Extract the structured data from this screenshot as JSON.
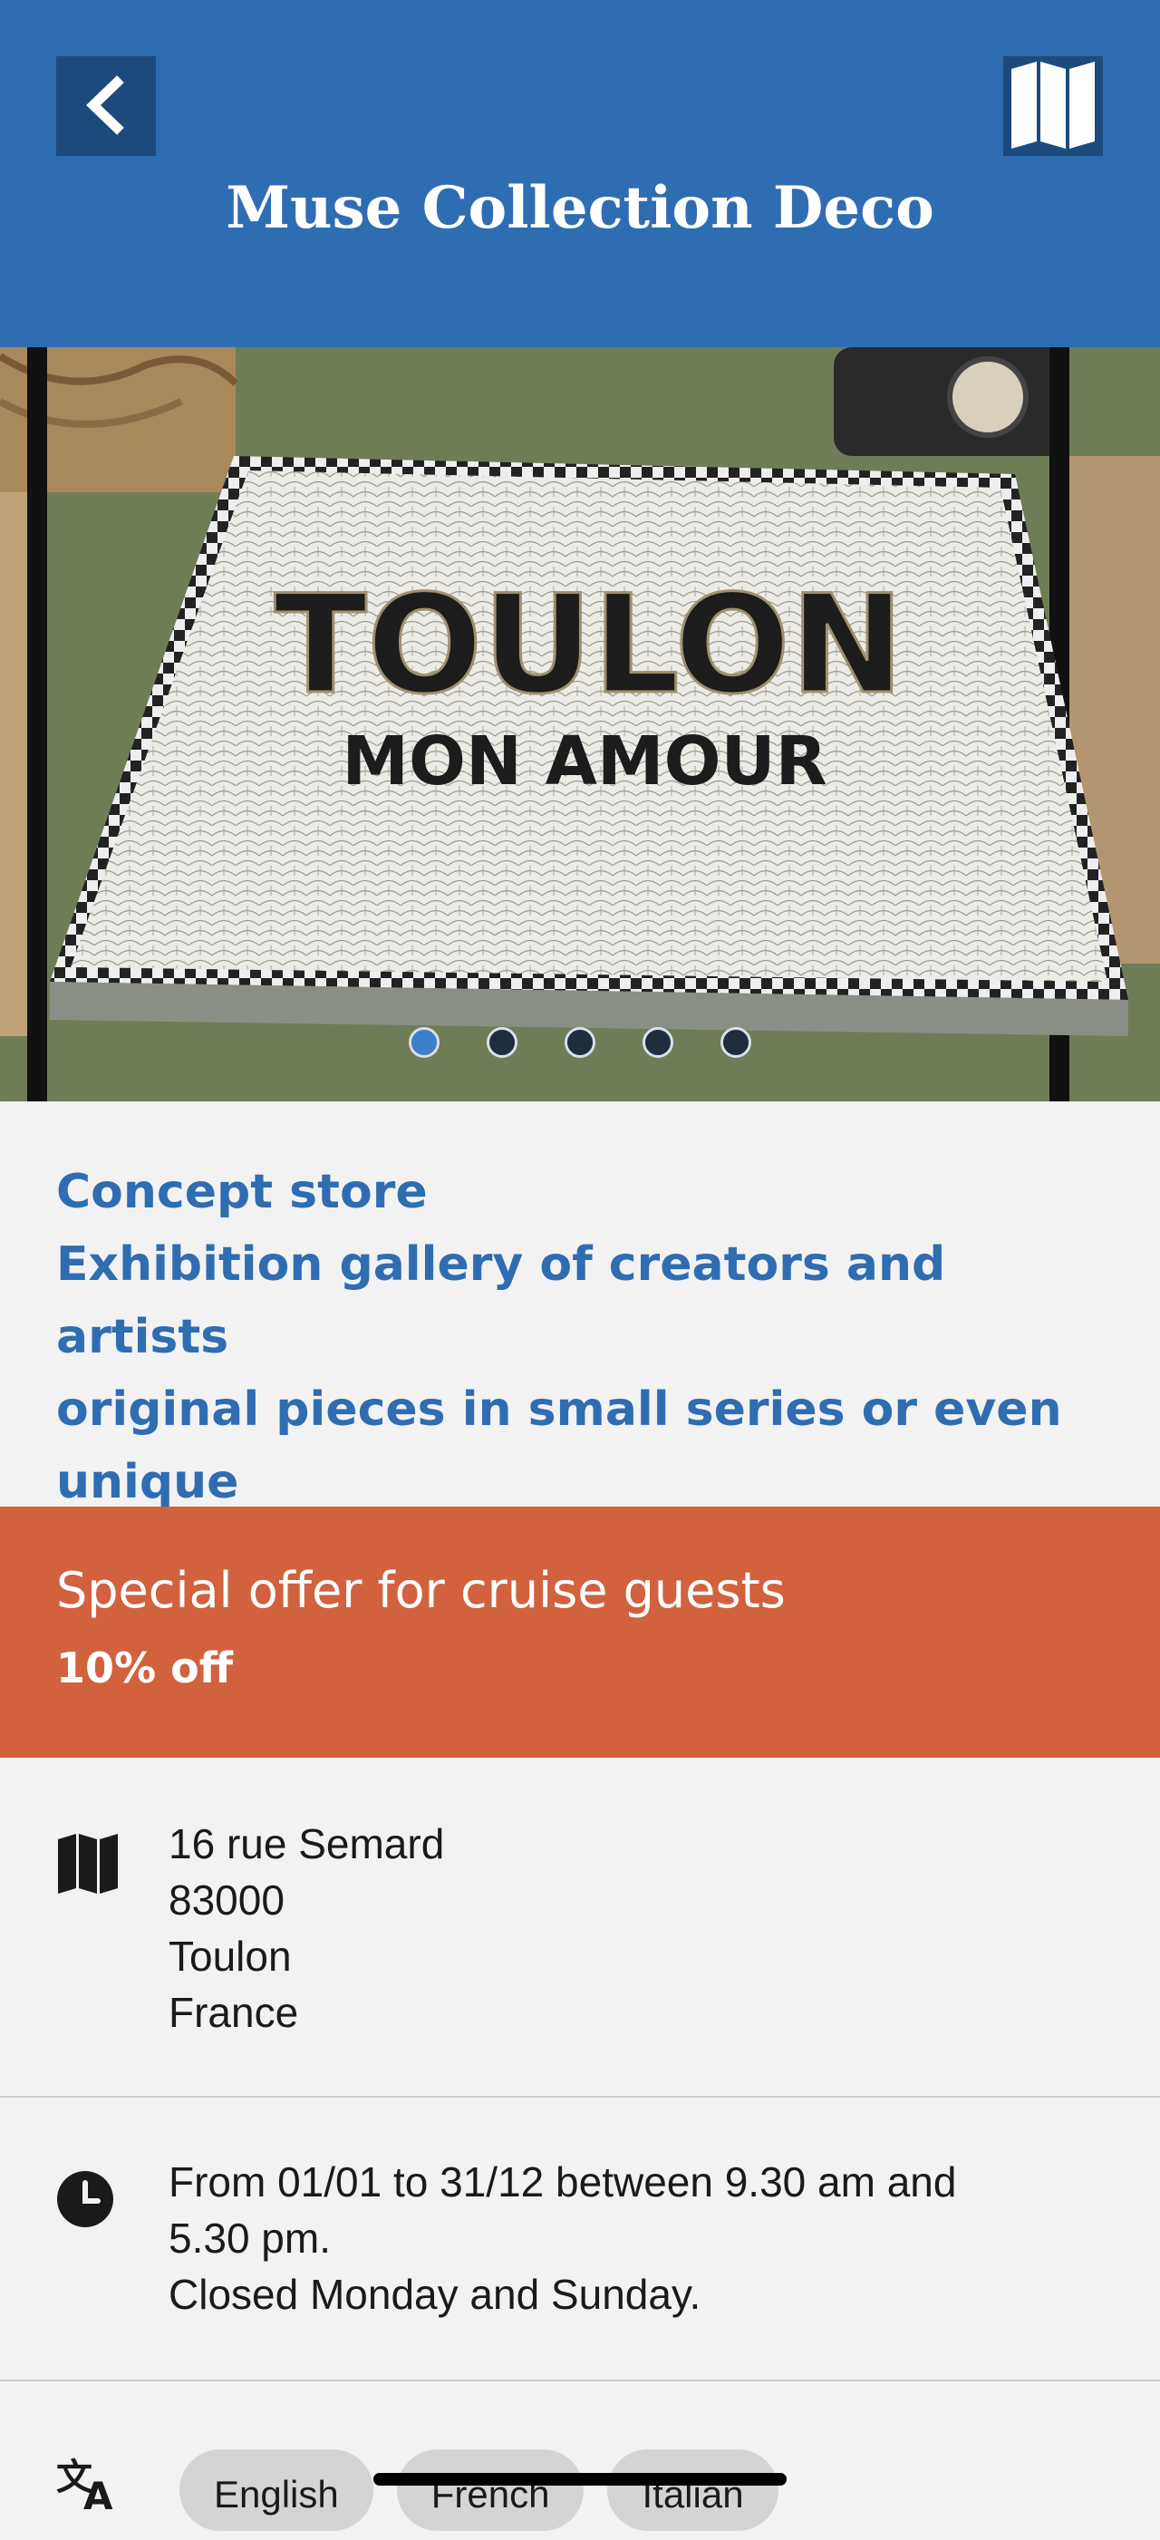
{
  "header": {
    "title": "Muse Collection Deco",
    "back_icon": "chevron-left-icon",
    "map_icon": "map-icon",
    "color": "#2f6db2"
  },
  "hero": {
    "sign_line1": "TOULON",
    "sign_line2": "MON AMOUR",
    "carousel": {
      "total": 5,
      "active": 1
    }
  },
  "description": {
    "lines": [
      "Concept store",
      "Exhibition gallery of creators and artists",
      "original pieces in small series or even",
      "unique"
    ],
    "color": "#2f6db2"
  },
  "offer": {
    "title": "Special offer for cruise guests",
    "value": "10% off",
    "color": "#d2613e"
  },
  "address": {
    "icon": "map-icon",
    "lines": [
      "16 rue Semard",
      "83000",
      "Toulon",
      "France"
    ]
  },
  "hours": {
    "icon": "clock-icon",
    "lines": [
      "From 01/01 to 31/12 between 9.30 am and",
      "5.30 pm.",
      "Closed Monday and Sunday."
    ]
  },
  "languages": {
    "icon": "translate-icon",
    "items": [
      "English",
      "French",
      "Italian"
    ]
  }
}
